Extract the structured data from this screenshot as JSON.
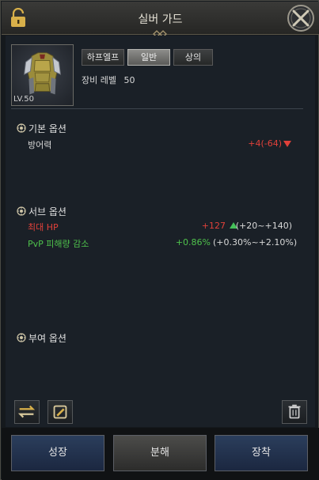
{
  "window": {
    "title": "실버 가드"
  },
  "item": {
    "level_text": "LV.50",
    "equip_level_label": "장비 레벨",
    "equip_level_value": "50"
  },
  "tabs": [
    {
      "label": "하프엘프",
      "active": false
    },
    {
      "label": "일반",
      "active": true
    },
    {
      "label": "상의",
      "active": false
    }
  ],
  "sections": {
    "basic": {
      "title": "기본 옵션",
      "rows": [
        {
          "label": "방어력",
          "value": "+4(-64)"
        }
      ]
    },
    "sub": {
      "title": "서브 옵션",
      "rows": [
        {
          "label": "최대 HP",
          "value": "+127",
          "range": "(+20~+140)"
        },
        {
          "label": "PvP 피해량 감소",
          "value": "+0.86%",
          "range": "(+0.30%~+2.10%)"
        }
      ]
    },
    "granted": {
      "title": "부여 옵션"
    }
  },
  "buttons": {
    "grow": "성장",
    "dismantle": "분해",
    "equip": "장착"
  },
  "colors": {
    "negative": "#e0413a",
    "hp_label": "#e0413a",
    "hp_value": "#e0413a",
    "up_arrow": "#45c15a",
    "pvp_label": "#4fc24c",
    "pvp_value": "#4fc24c"
  },
  "icons": [
    "lock-icon",
    "close-icon",
    "swap-icon",
    "preset-icon",
    "trash-icon",
    "option-icon",
    "down-arrow-icon",
    "up-arrow-icon"
  ]
}
